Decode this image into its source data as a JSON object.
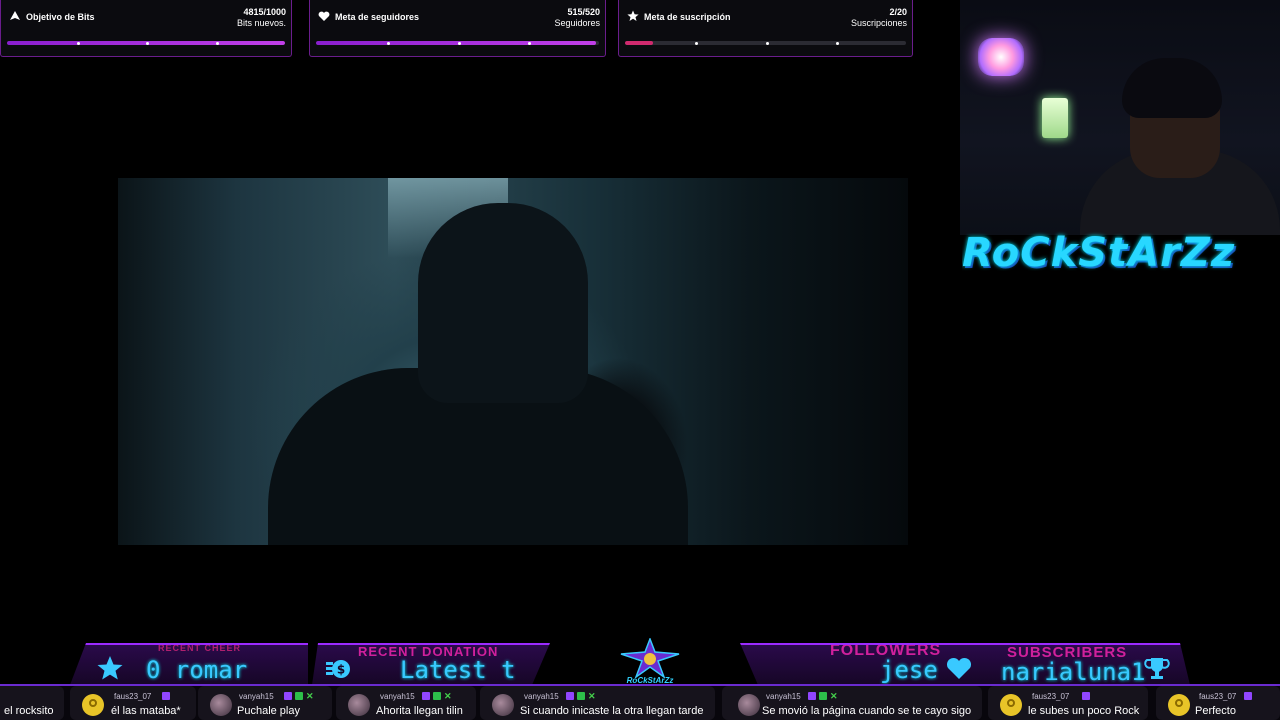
{
  "goals": [
    {
      "title": "Objetivo de Bits",
      "count": "4815/1000",
      "count_label": "Bits nuevos.",
      "progress": 1.0,
      "icon": "bits-icon"
    },
    {
      "title": "Meta de seguidores",
      "count": "515/520",
      "count_label": "Seguidores",
      "progress": 0.99,
      "icon": "heart-icon"
    },
    {
      "title": "Meta de suscripción",
      "count": "2/20",
      "count_label": "Suscripciones",
      "progress": 0.1,
      "icon": "star-icon"
    }
  ],
  "streamer_logo": "RoCkStArZz",
  "stats": {
    "recent_cheer_label": "RECENT CHEER",
    "recent_cheer_value": "0  romar",
    "recent_donation_label": "RECENT DONATION",
    "recent_donation_value": "Latest t",
    "followers_label": "FOLLOWERS",
    "followers_value": "jese",
    "subscribers_label": "SUBSCRIBERS",
    "subscribers_value": "narialuna1",
    "center_logo_text": "RoCkStArZz"
  },
  "chat": [
    {
      "user": "",
      "msg": "el rocksito",
      "avatar": "none"
    },
    {
      "user": "faus23_07",
      "msg": "él las mataba*",
      "avatar": "yellow"
    },
    {
      "user": "vanyah15",
      "msg": "Puchale play",
      "avatar": "photo"
    },
    {
      "user": "vanyah15",
      "msg": "Ahorita llegan tilin",
      "avatar": "photo"
    },
    {
      "user": "vanyah15",
      "msg": "Si cuando inicaste la otra llegan tarde",
      "avatar": "photo"
    },
    {
      "user": "vanyah15",
      "msg": "Se movió la página cuando se te cayo sigo",
      "avatar": "photo"
    },
    {
      "user": "faus23_07",
      "msg": "le subes un poco Rock",
      "avatar": "yellow"
    },
    {
      "user": "faus23_07",
      "msg": "Perfecto",
      "avatar": "yellow"
    }
  ],
  "colors": {
    "accent": "#9b2bff",
    "cyan": "#39c9ff",
    "pink": "#d0209c"
  }
}
